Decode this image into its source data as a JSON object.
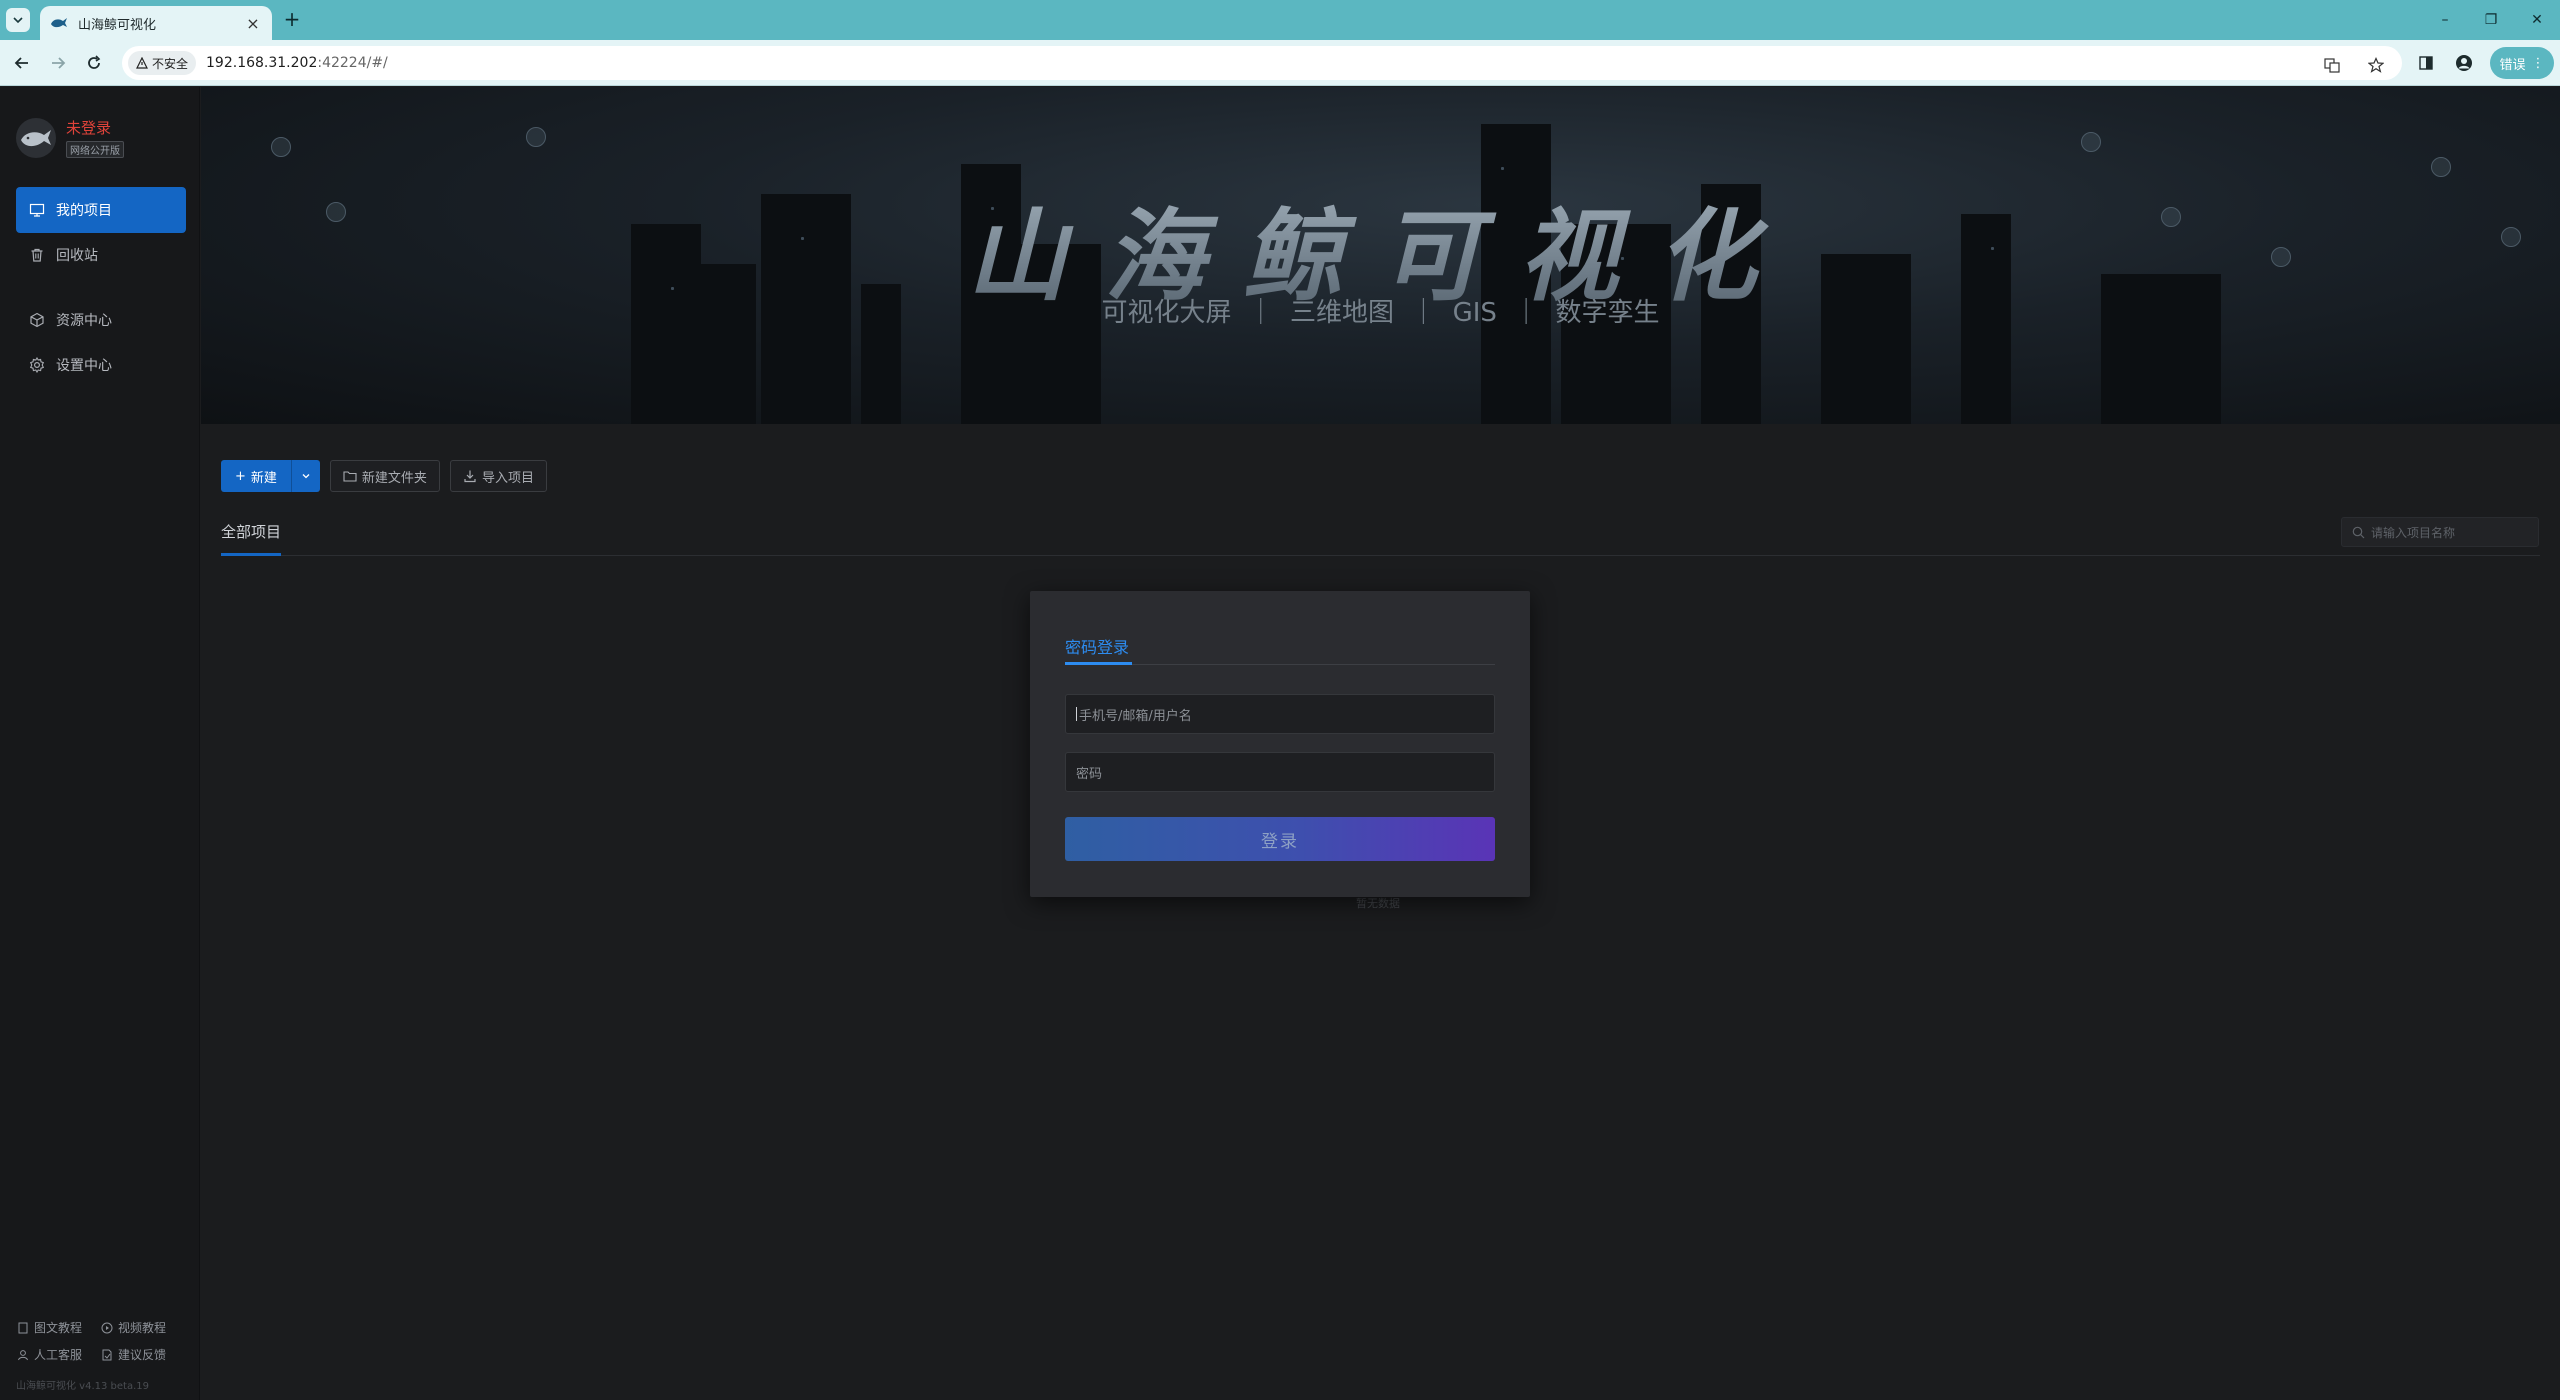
{
  "browser": {
    "tab_title": "山海鲸可视化",
    "tab_close": "×",
    "new_tab": "+",
    "security_label": "不安全",
    "url_host": "192.168.31.202",
    "url_rest": ":42224/#/",
    "error_label": "错误",
    "window_minimize": "–",
    "window_restore": "❐",
    "window_close": "✕"
  },
  "sidebar": {
    "user_name": "未登录",
    "user_badge": "网络公开版",
    "items": [
      {
        "label": "我的项目",
        "icon": "monitor-icon",
        "active": true
      },
      {
        "label": "回收站",
        "icon": "trash-icon",
        "active": false
      },
      {
        "label": "资源中心",
        "icon": "cube-icon",
        "active": false
      },
      {
        "label": "设置中心",
        "icon": "gear-icon",
        "active": false
      }
    ],
    "footer": [
      {
        "label": "图文教程",
        "icon": "document-icon"
      },
      {
        "label": "视频教程",
        "icon": "play-circle-icon"
      },
      {
        "label": "人工客服",
        "icon": "user-icon"
      },
      {
        "label": "建议反馈",
        "icon": "feedback-icon"
      }
    ],
    "version": "山海鲸可视化 v4.13 beta.19"
  },
  "banner": {
    "title": "山海鲸可视化",
    "subtitle": "可视化大屏 ｜ 三维地图 ｜ GIS ｜ 数字孪生"
  },
  "actions": {
    "new_label": "新建",
    "new_folder_label": "新建文件夹",
    "import_label": "导入项目"
  },
  "tabs": {
    "all_projects": "全部项目"
  },
  "search": {
    "placeholder": "请输入项目名称"
  },
  "empty": {
    "text": "暂无数据"
  },
  "login": {
    "tab_label": "密码登录",
    "username_placeholder": "手机号/邮箱/用户名",
    "password_placeholder": "密码",
    "submit_label": "登录"
  },
  "colors": {
    "accent": "#1466c4",
    "browser_frame": "#5bb7c1",
    "unlogged_red": "#e0433a"
  }
}
